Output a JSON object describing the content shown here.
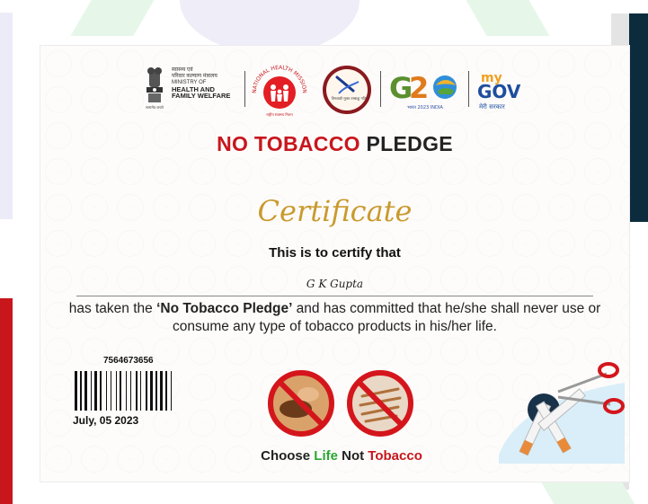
{
  "logos": {
    "ministry_line1": "स्वास्थ्य एवं",
    "ministry_line2": "परिवार कल्याण मंत्रालय",
    "ministry_line3": "MINISTRY OF",
    "ministry_line4": "HEALTH AND",
    "ministry_line5": "FAMILY WELFARE",
    "emblem_caption": "सत्यमेव जयते",
    "nhm_arc": "NATIONAL HEALTH MISSION",
    "nhm_caption": "राष्ट्रीय स्वास्थ्य मिशन",
    "circle_caption": "तिरुवकौ मुक्त तम्बाकू गति",
    "g20_caption": "भारत 2023 INDIA",
    "mygov_my": "my",
    "mygov_gov": "GOV",
    "mygov_caption": "मेरी सरकार"
  },
  "title": {
    "red": "NO TOBACCO",
    "dark": "PLEDGE"
  },
  "certificate_word": "Certificate",
  "certify_text": "This is to certify that",
  "recipient_name": "G K Gupta",
  "body": {
    "part1": "has taken the ",
    "bold": "‘No Tobacco Pledge’",
    "part2": " and has committed that he/she shall never use or consume any type of tobacco products in his/her life."
  },
  "certificate_number": "7564673656",
  "date": "July, 05 2023",
  "tagline": {
    "w1": "Choose ",
    "w2": "Life",
    "w3": " Not ",
    "w4": "Tobacco"
  },
  "colors": {
    "accent_red": "#c8161c",
    "accent_green": "#2aa833",
    "gold": "#c99a2e",
    "navy": "#0c2c3e"
  },
  "icons": [
    "ashoka-emblem-icon",
    "nhm-logo-icon",
    "no-tobacco-circle-icon",
    "g20-logo-icon",
    "mygov-logo-icon",
    "no-chewing-tobacco-icon",
    "no-cigarettes-icon",
    "broken-cigarettes-scissors-icon",
    "barcode-icon"
  ]
}
